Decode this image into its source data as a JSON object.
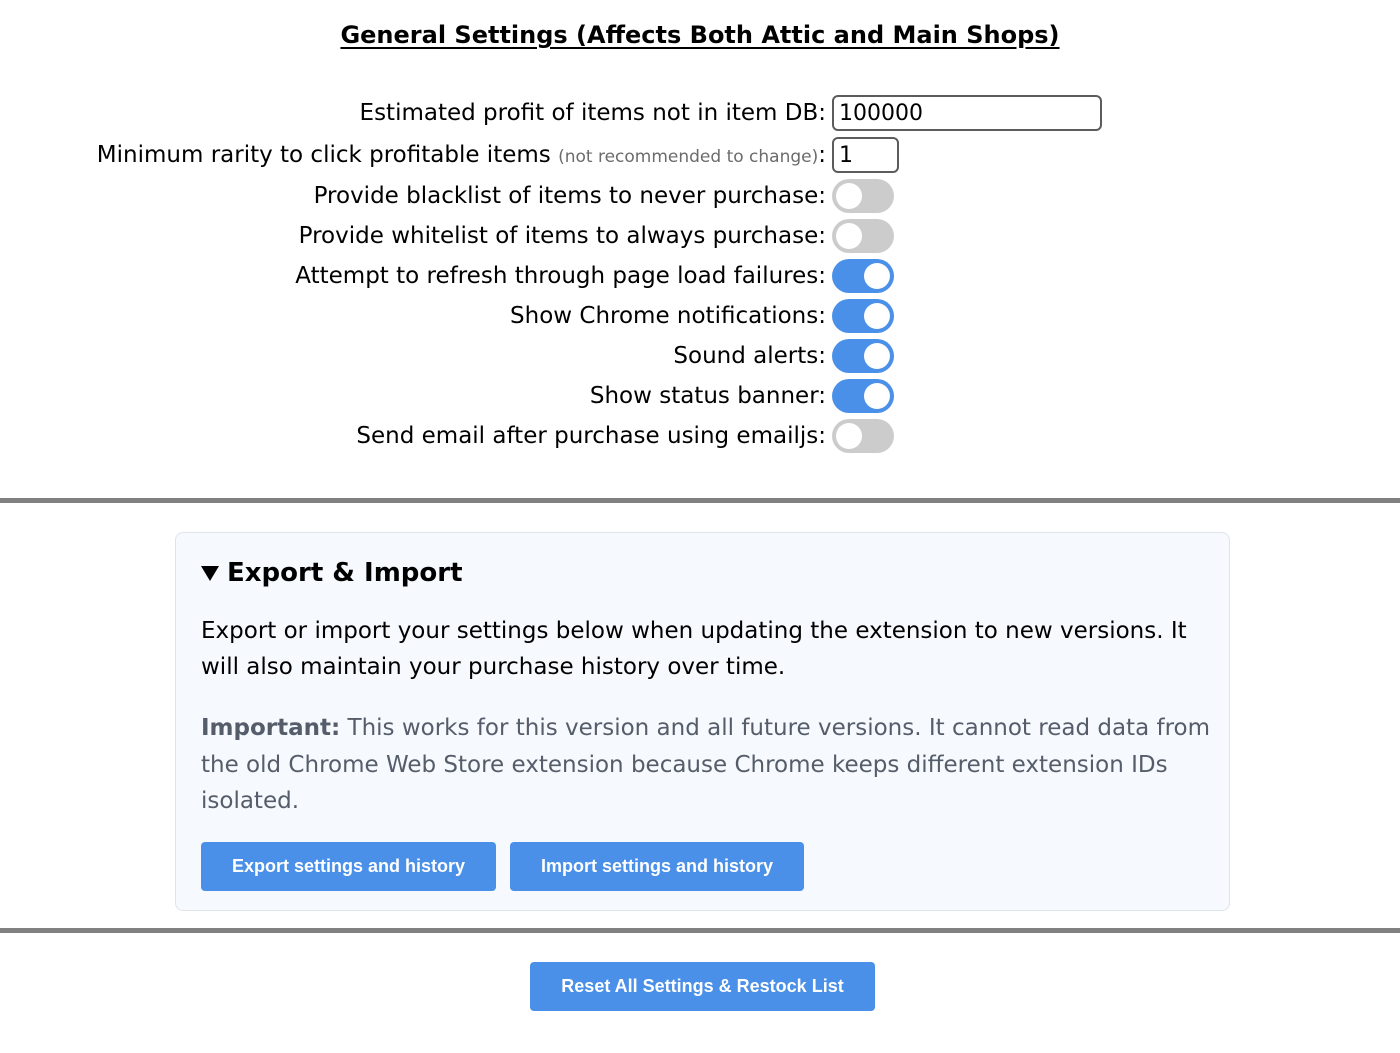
{
  "general": {
    "title": "General Settings (Affects Both Attic and Main Shops)",
    "settings": [
      {
        "label": "Estimated profit of items not in item DB:",
        "hint": "",
        "type": "text",
        "value": "100000"
      },
      {
        "label": "Minimum rarity to click profitable items",
        "hint": "(not recommended to change)",
        "suffix": ":",
        "type": "text",
        "value": "1"
      },
      {
        "label": "Provide blacklist of items to never purchase:",
        "hint": "",
        "type": "toggle",
        "on": false
      },
      {
        "label": "Provide whitelist of items to always purchase:",
        "hint": "",
        "type": "toggle",
        "on": false
      },
      {
        "label": "Attempt to refresh through page load failures:",
        "hint": "",
        "type": "toggle",
        "on": true
      },
      {
        "label": "Show Chrome notifications:",
        "hint": "",
        "type": "toggle",
        "on": true
      },
      {
        "label": "Sound alerts:",
        "hint": "",
        "type": "toggle",
        "on": true
      },
      {
        "label": "Show status banner:",
        "hint": "",
        "type": "toggle",
        "on": true
      },
      {
        "label": "Send email after purchase using emailjs:",
        "hint": "",
        "type": "toggle",
        "on": false
      }
    ]
  },
  "export_import": {
    "summary": "Export & Import",
    "description": "Export or import your settings below when updating the extension to new versions. It will also maintain your purchase history over time.",
    "note_strong": "Important:",
    "note_text": " This works for this version and all future versions. It cannot read data from the old Chrome Web Store extension because Chrome keeps different extension IDs isolated.",
    "export_label": "Export settings and history",
    "import_label": "Import settings and history"
  },
  "reset_label": "Reset All Settings & Restock List",
  "colors": {
    "accent": "#4a8fe8",
    "toggle_off": "#cccccc",
    "panel_bg": "#f6f9fd",
    "divider": "#808080"
  }
}
